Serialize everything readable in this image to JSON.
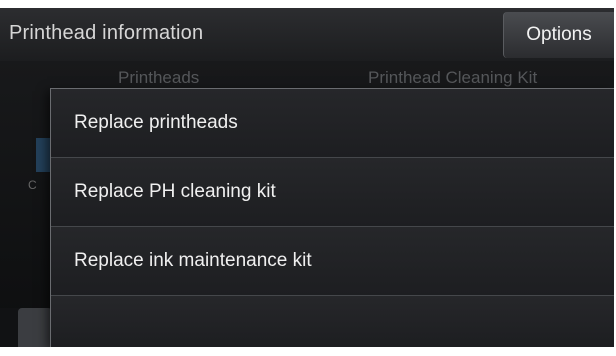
{
  "header": {
    "title": "Printhead information",
    "options_label": "Options"
  },
  "background": {
    "col1_label": "Printheads",
    "col2_label": "Printhead Cleaning Kit",
    "side_letter": "C"
  },
  "menu": {
    "items": [
      {
        "label": "Replace printheads"
      },
      {
        "label": "Replace PH cleaning kit"
      },
      {
        "label": "Replace ink maintenance kit"
      }
    ]
  },
  "colors": {
    "background": "#0d0e0f",
    "title_bar": "#2c2d30",
    "menu": "#202124",
    "accent_blue": "#1e6fa0"
  }
}
